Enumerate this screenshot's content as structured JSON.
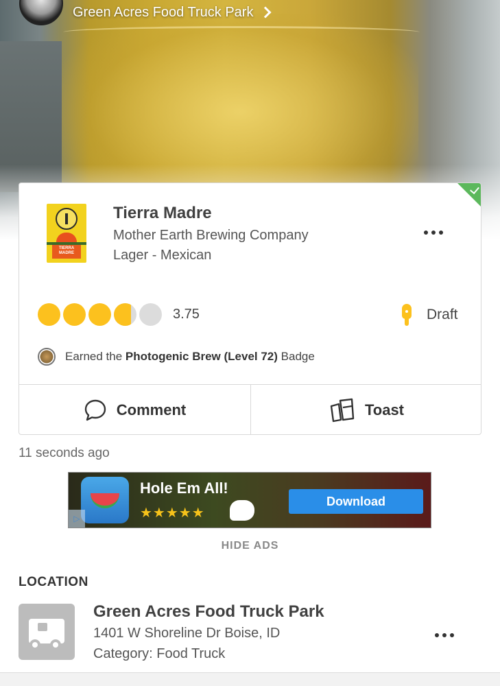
{
  "header": {
    "venue_name": "Green Acres Food Truck Park",
    "avatar_icon": "user-avatar",
    "chevron_icon": "chevron-right-icon"
  },
  "checkin": {
    "beer_name": "Tierra Madre",
    "brewery": "Mother Earth Brewing Company",
    "style": "Lager - Mexican",
    "label_text": "TIERRA MADRE",
    "rating": 3.75,
    "rating_display": "3.75",
    "rating_max": 5,
    "serving": "Draft",
    "badge": {
      "prefix": "Earned the",
      "name": "Photogenic Brew (Level 72)",
      "suffix": "Badge"
    },
    "actions": {
      "comment": "Comment",
      "toast": "Toast"
    },
    "verified": true,
    "timestamp": "11 seconds ago"
  },
  "ad": {
    "title": "Hole Em All!",
    "stars": "★★★★★",
    "rating_stars": 4.5,
    "cta": "Download",
    "choices_icon": "▷"
  },
  "hide_ads_label": "HIDE ADS",
  "location": {
    "section_title": "LOCATION",
    "venue_name": "Green Acres Food Truck Park",
    "address": "1401 W Shoreline Dr Boise, ID",
    "category": "Category: Food Truck",
    "icon": "food-truck-icon"
  },
  "colors": {
    "accent": "#fcc11e",
    "verified": "#5cb85c",
    "ad_button": "#2a8ee8"
  }
}
